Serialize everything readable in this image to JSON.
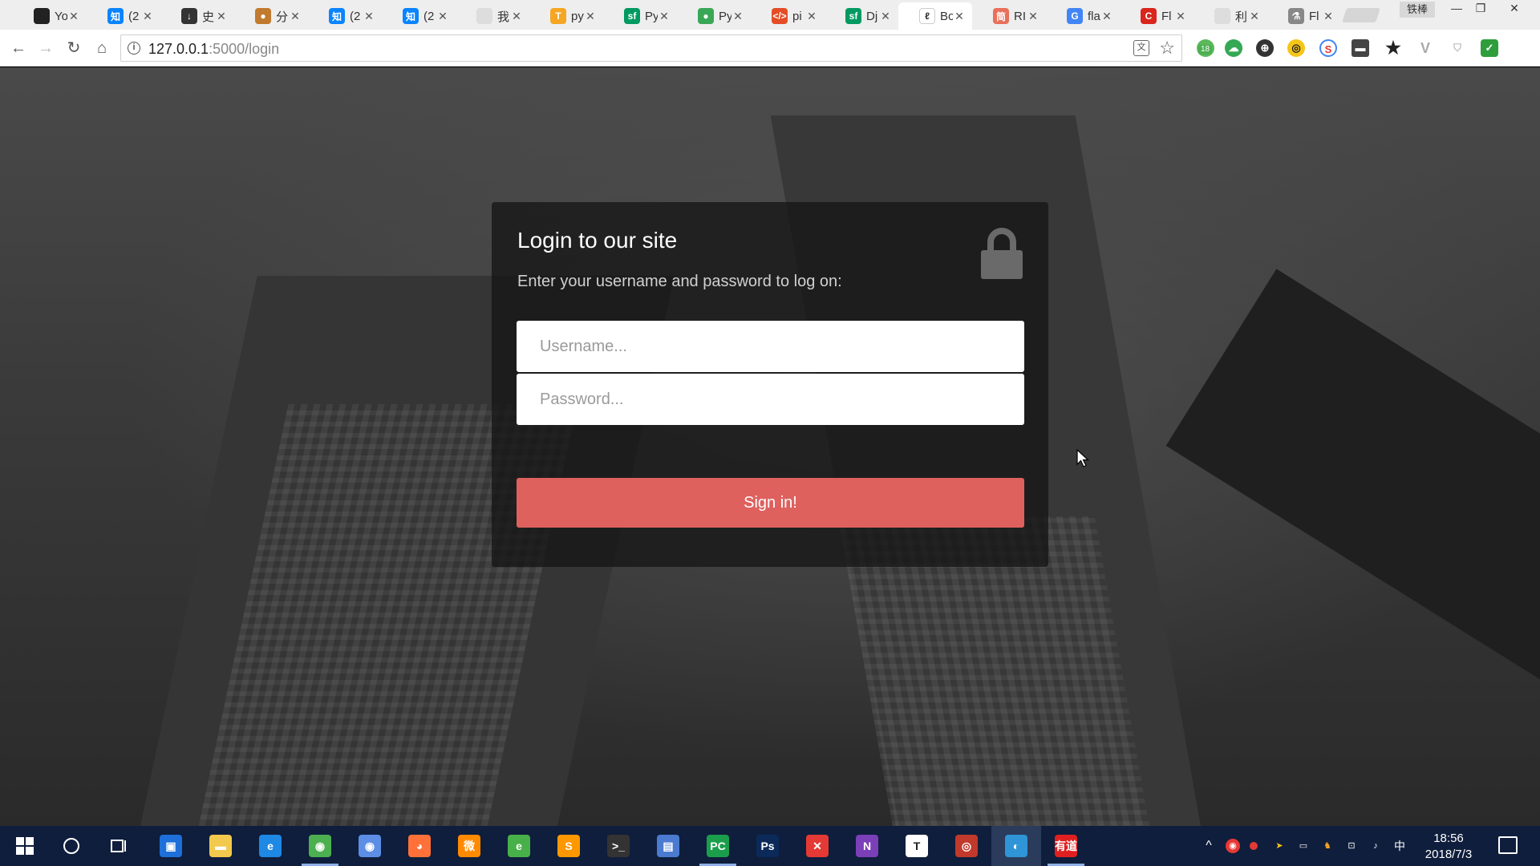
{
  "browser": {
    "tabs": [
      {
        "title": "Yo",
        "icon_char": "",
        "icon_color": "#222222",
        "icon": "github-icon"
      },
      {
        "title": "(2",
        "icon_char": "知",
        "icon_color": "#0a84ff",
        "icon": "zhihu-icon"
      },
      {
        "title": "史",
        "icon_char": "↓",
        "icon_color": "#333333",
        "icon": "download-site-icon"
      },
      {
        "title": "分",
        "icon_char": "●",
        "icon_color": "#c17a2e",
        "icon": "share-site-icon"
      },
      {
        "title": "(2",
        "icon_char": "知",
        "icon_color": "#0a84ff",
        "icon": "zhihu-icon"
      },
      {
        "title": "(2",
        "icon_char": "知",
        "icon_color": "#0a84ff",
        "icon": "zhihu-icon"
      },
      {
        "title": "我",
        "icon_char": "",
        "icon_color": "#dddddd",
        "icon": "page-icon"
      },
      {
        "title": "py",
        "icon_char": "T",
        "icon_color": "#f5a623",
        "icon": "tutorial-icon"
      },
      {
        "title": "Py",
        "icon_char": "sf",
        "icon_color": "#009a61",
        "icon": "segmentfault-icon"
      },
      {
        "title": "Py",
        "icon_char": "●",
        "icon_color": "#3aa757",
        "icon": "python-site-icon"
      },
      {
        "title": "pi",
        "icon_char": "</>",
        "icon_color": "#e44d26",
        "icon": "code-icon"
      },
      {
        "title": "Dj",
        "icon_char": "sf",
        "icon_color": "#009a61",
        "icon": "segmentfault-icon"
      },
      {
        "title": "Bo",
        "icon_char": "ℓ",
        "icon_color": "#ffffff",
        "icon": "blog-icon",
        "active": true
      },
      {
        "title": "RI",
        "icon_char": "简",
        "icon_color": "#ea6f5a",
        "icon": "jianshu-icon"
      },
      {
        "title": "fla",
        "icon_char": "G",
        "icon_color": "#4285f4",
        "icon": "google-icon"
      },
      {
        "title": "Fl",
        "icon_char": "C",
        "icon_color": "#d9251d",
        "icon": "csdn-icon"
      },
      {
        "title": "利",
        "icon_char": "",
        "icon_color": "#dddddd",
        "icon": "page-icon"
      },
      {
        "title": "Fl",
        "icon_char": "⚗",
        "icon_color": "#888888",
        "icon": "flask-icon"
      }
    ],
    "window_user": "铁棒",
    "window_controls": [
      "—",
      "❐",
      "✕"
    ],
    "nav": {
      "back": "←",
      "forward": "→",
      "reload": "↻",
      "home": "⌂"
    },
    "url_host": "127.0.0.1",
    "url_path": ":5000/login",
    "extension_badge": "18"
  },
  "login": {
    "title": "Login to our site",
    "subtitle": "Enter your username and password to log on:",
    "username_placeholder": "Username...",
    "password_placeholder": "Password...",
    "submit_label": "Sign in!"
  },
  "taskbar": {
    "ime": "中",
    "time": "18:56",
    "date": "2018/7/3",
    "apps": [
      {
        "name": "store-icon",
        "char": "▣",
        "color": "#1e6fd9"
      },
      {
        "name": "file-explorer-icon",
        "char": "▬",
        "color": "#f2c94c"
      },
      {
        "name": "edge-icon",
        "char": "e",
        "color": "#1e88e5"
      },
      {
        "name": "chrome-icon",
        "char": "◉",
        "color": "#4caf50",
        "running": true
      },
      {
        "name": "chrome-canary-icon",
        "char": "◉",
        "color": "#5c8ee6"
      },
      {
        "name": "firefox-icon",
        "char": "◕",
        "color": "#ff7139"
      },
      {
        "name": "weibo-icon",
        "char": "微",
        "color": "#ff8a00"
      },
      {
        "name": "ie-green-icon",
        "char": "e",
        "color": "#48b048"
      },
      {
        "name": "sublime-icon",
        "char": "S",
        "color": "#ff9800"
      },
      {
        "name": "terminal-icon",
        "char": ">_",
        "color": "#333333"
      },
      {
        "name": "remote-desktop-icon",
        "char": "▤",
        "color": "#4a7bd1"
      },
      {
        "name": "pycharm-icon",
        "char": "PC",
        "color": "#1b9e4b",
        "running": true
      },
      {
        "name": "photoshop-icon",
        "char": "Ps",
        "color": "#0b2a5a"
      },
      {
        "name": "xmind-icon",
        "char": "✕",
        "color": "#e53935"
      },
      {
        "name": "onenote-icon",
        "char": "N",
        "color": "#7b3fb8"
      },
      {
        "name": "typora-icon",
        "char": "T",
        "color": "#ffffff"
      },
      {
        "name": "snail-icon",
        "char": "◎",
        "color": "#c0392b"
      },
      {
        "name": "browser-app-icon",
        "char": "◐",
        "color": "#2f95d6",
        "active": true
      },
      {
        "name": "youdao-icon",
        "char": "有道",
        "color": "#e02020",
        "running": true
      }
    ]
  }
}
